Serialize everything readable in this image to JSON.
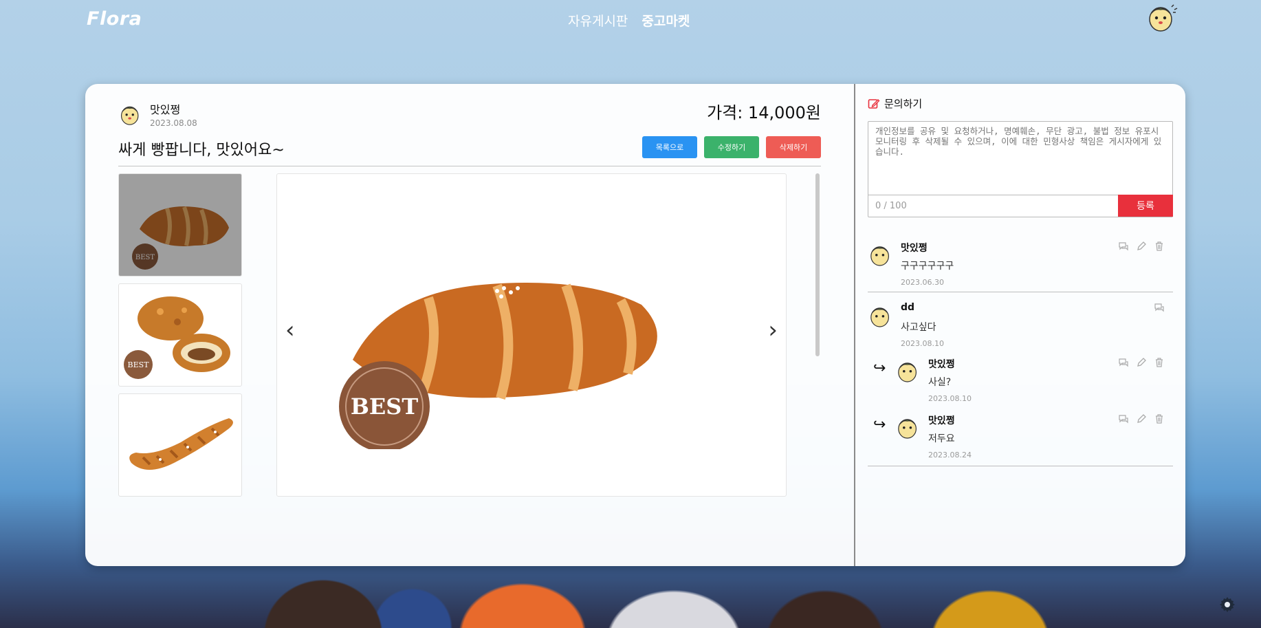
{
  "nav": {
    "logo": "Flora",
    "links": [
      {
        "label": "자유게시판",
        "active": false
      },
      {
        "label": "중고마켓",
        "active": true
      }
    ],
    "user_avatar_icon": "mascot-avatar-icon"
  },
  "post": {
    "author": "맛있쩡",
    "date": "2023.08.08",
    "price_label": "가격: 14,000원",
    "title": "싸게 빵팝니다, 맛있어요~",
    "buttons": {
      "list": "목록으로",
      "edit": "수정하기",
      "delete": "삭제하기"
    },
    "images": [
      "salt-bread",
      "croquette-bread",
      "twisted-bread"
    ],
    "selected_image": 0,
    "badge_text": "BEST"
  },
  "inquiry": {
    "title": "문의하기",
    "placeholder": "개인정보를 공유 및 요청하거나, 명예훼손, 무단 광고, 불법 정보 유포시 모니터링 후 삭제될 수 있으며, 이에 대한 민형사상 책임은 게시자에게 있습니다.",
    "counter": "0 / 100",
    "submit": "등록"
  },
  "comments": [
    {
      "author": "맛있쩡",
      "body": "구구구구구구",
      "date": "2023.06.30",
      "reply": false,
      "actions": [
        "reply",
        "edit",
        "delete"
      ]
    },
    {
      "author": "dd",
      "body": "사고싶다",
      "date": "2023.08.10",
      "reply": false,
      "actions": [
        "reply"
      ]
    },
    {
      "author": "맛있쩡",
      "body": "사실?",
      "date": "2023.08.10",
      "reply": true,
      "actions": [
        "reply",
        "edit",
        "delete"
      ]
    },
    {
      "author": "맛있쩡",
      "body": "저두요",
      "date": "2023.08.24",
      "reply": true,
      "actions": [
        "reply",
        "edit",
        "delete"
      ]
    }
  ],
  "reply_marker": "↪",
  "colors": {
    "list_button": "#2a93f2",
    "edit_button": "#3bb26b",
    "delete_button": "#ee5c55",
    "submit_button": "#e8303c"
  }
}
